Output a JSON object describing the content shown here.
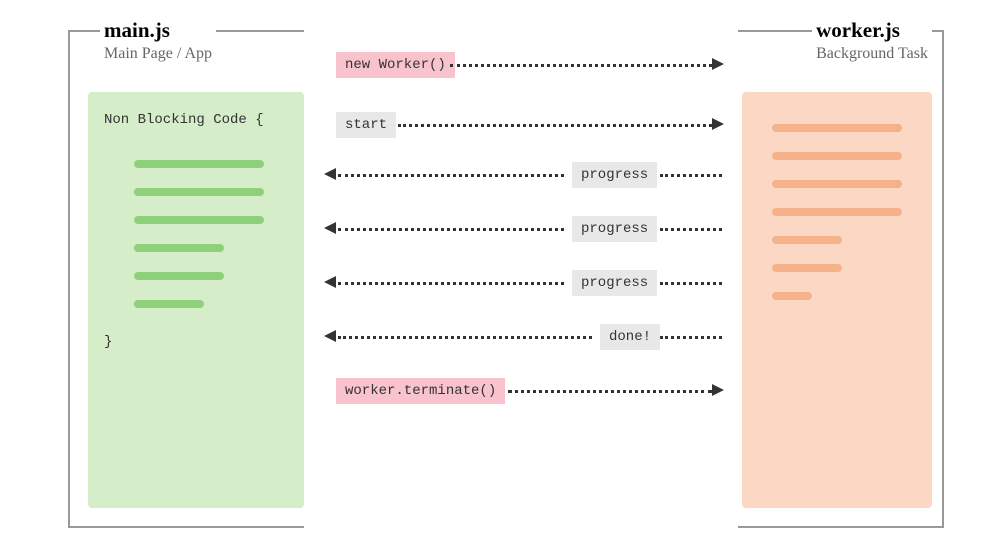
{
  "left": {
    "title": "main.js",
    "subtitle": "Main Page / App",
    "code_label": "Non Blocking Code {",
    "code_brace": "}"
  },
  "right": {
    "title": "worker.js",
    "subtitle": "Background Task"
  },
  "messages": {
    "new_worker": "new Worker()",
    "start": "start",
    "progress1": "progress",
    "progress2": "progress",
    "progress3": "progress",
    "done": "done!",
    "terminate": "worker.terminate()"
  },
  "code_lines_main_widths": [
    130,
    130,
    130,
    90,
    90,
    70
  ],
  "code_lines_worker_widths": [
    130,
    130,
    130,
    130,
    70,
    70,
    40
  ]
}
